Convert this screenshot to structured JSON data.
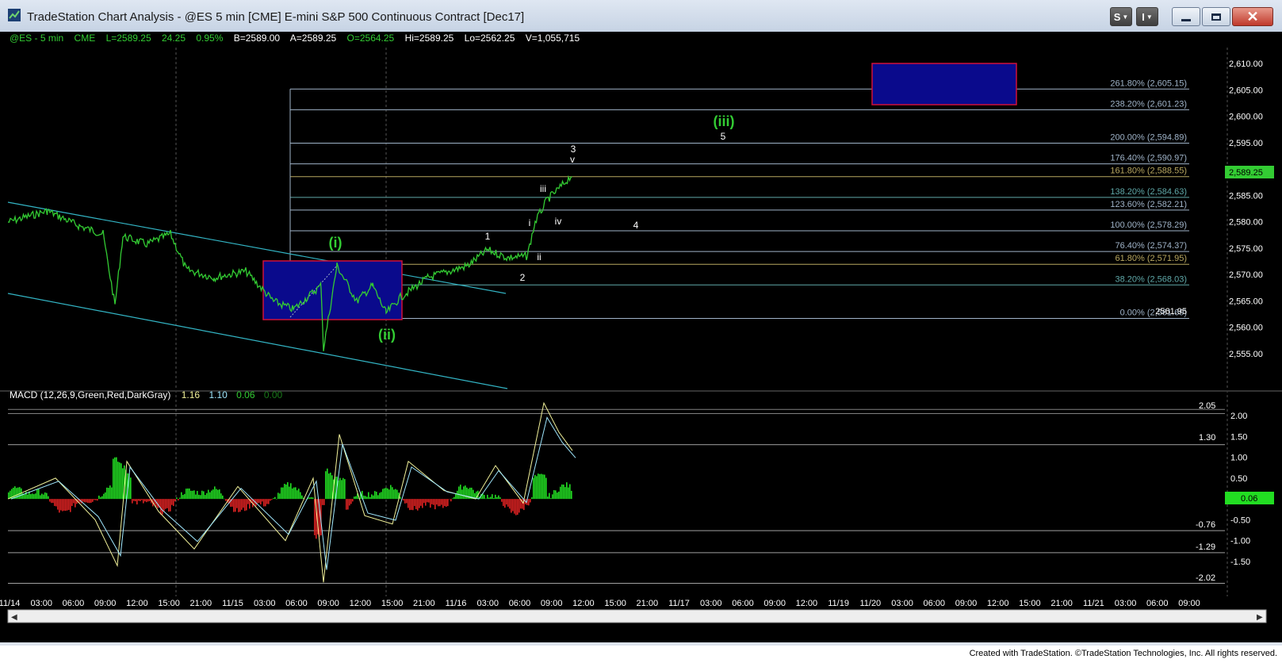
{
  "window": {
    "title": "TradeStation Chart Analysis - @ES 5 min [CME] E-mini S&P 500 Continuous Contract [Dec17]",
    "buttons": {
      "s": "S",
      "i": "I"
    }
  },
  "header": {
    "symbol": "@ES - 5 min",
    "exchange": "CME",
    "last": "L=2589.25",
    "change": "24.25",
    "pct": "0.95%",
    "bid": "B=2589.00",
    "ask": "A=2589.25",
    "open": "O=2564.25",
    "high": "Hi=2589.25",
    "low": "Lo=2562.25",
    "volume": "V=1,055,715"
  },
  "price_axis": {
    "ticks": [
      "2,610.00",
      "2,605.00",
      "2,600.00",
      "2,595.00",
      "2,590.00",
      "2,585.00",
      "2,580.00",
      "2,575.00",
      "2,570.00",
      "2,565.00",
      "2,560.00",
      "2,555.00"
    ],
    "last_price": "2,589.25"
  },
  "fib_levels": [
    {
      "label": "261.80% (2,605.15)",
      "price": 2605.15,
      "color": "#9fb3c8"
    },
    {
      "label": "238.20% (2,601.23)",
      "price": 2601.23,
      "color": "#9fb3c8"
    },
    {
      "label": "200.00% (2,594.89)",
      "price": 2594.89,
      "color": "#9fb3c8"
    },
    {
      "label": "176.40% (2,590.97)",
      "price": 2590.97,
      "color": "#9fb3c8"
    },
    {
      "label": "161.80% (2,588.55)",
      "price": 2588.55,
      "color": "#b8a760"
    },
    {
      "label": "138.20% (2,584.63)",
      "price": 2584.63,
      "color": "#5fa8a8"
    },
    {
      "label": "123.60% (2,582.21)",
      "price": 2582.21,
      "color": "#9fb3c8"
    },
    {
      "label": "100.00% (2,578.29)",
      "price": 2578.29,
      "color": "#9fb3c8"
    },
    {
      "label": "76.40% (2,574.37)",
      "price": 2574.37,
      "color": "#9fb3c8"
    },
    {
      "label": "61.80% (2,571.95)",
      "price": 2571.95,
      "color": "#b8a760"
    },
    {
      "label": "38.20% (2,568.03)",
      "price": 2568.03,
      "color": "#5fa8a8"
    },
    {
      "label": "0.00% (2,561.69)",
      "price": 2561.69,
      "color": "#9fb3c8"
    }
  ],
  "price_marker": {
    "label": "2561.95",
    "price": 2561.95
  },
  "wave_labels": {
    "green": {
      "i": "(i)",
      "ii": "(ii)",
      "iii": "(iii)"
    },
    "white": {
      "one": "1",
      "two": "2",
      "three": "3",
      "four": "4",
      "five": "5",
      "mi": "i",
      "mii": "ii",
      "miii": "iii",
      "miv": "iv",
      "mv": "v"
    }
  },
  "macd": {
    "label": "MACD (12,26,9,Green,Red,DarkGray)",
    "v1": "1.16",
    "v2": "1.10",
    "v3": "0.06",
    "v4": "0.00",
    "axis_ticks": [
      "2.00",
      "1.50",
      "1.00",
      "0.50",
      "-0.50",
      "-1.00",
      "-1.50"
    ],
    "current": "0.06",
    "level_labels": {
      "a": "2.05",
      "b": "1.30",
      "c": "-0.76",
      "d": "-1.29",
      "e": "-2.02"
    }
  },
  "time_axis": [
    "11/14",
    "03:00",
    "06:00",
    "09:00",
    "12:00",
    "15:00",
    "21:00",
    "11/15",
    "03:00",
    "06:00",
    "09:00",
    "12:00",
    "15:00",
    "21:00",
    "11/16",
    "03:00",
    "06:00",
    "09:00",
    "12:00",
    "15:00",
    "21:00",
    "11/17",
    "03:00",
    "06:00",
    "09:00",
    "12:00",
    "11/19",
    "11/20",
    "03:00",
    "06:00",
    "09:00",
    "12:00",
    "15:00",
    "21:00",
    "11/21",
    "03:00",
    "06:00",
    "09:00"
  ],
  "colors": {
    "background": "#000000",
    "price_line": "#33cc33",
    "channel": "#33b5c5",
    "green_label": "#33cc33",
    "box_fill": "#0a0a8c",
    "box_border": "#d0103a",
    "macd_pos": "#22dd22",
    "macd_neg": "#dd2222",
    "macd_line": "#f2f29a",
    "signal_line": "#a0e8ff"
  },
  "footer": "Created with TradeStation. ©TradeStation Technologies, Inc. All rights reserved."
}
